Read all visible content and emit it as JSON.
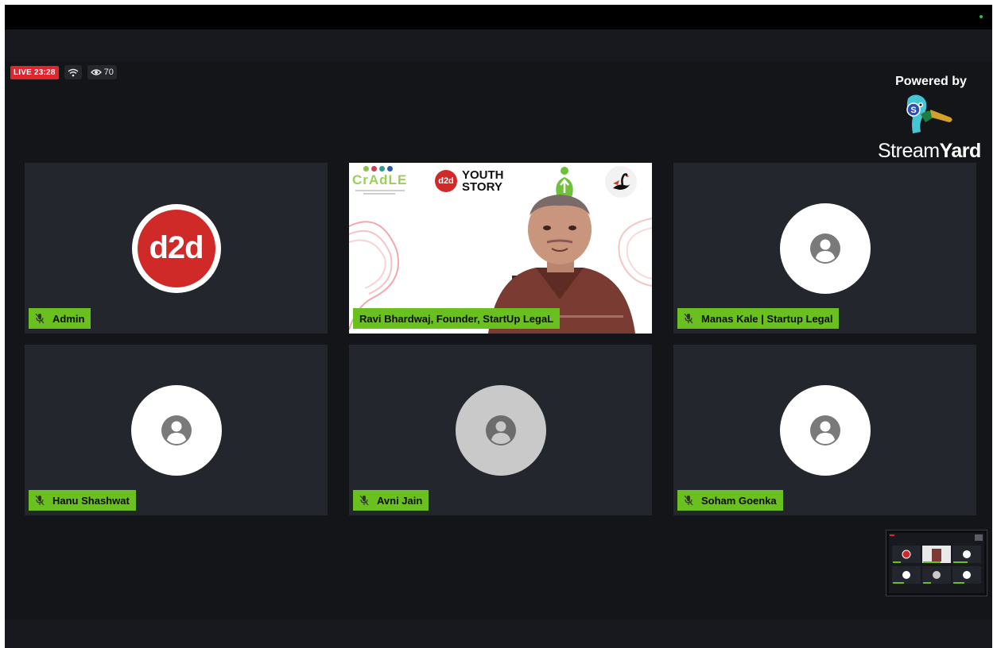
{
  "stream": {
    "live_label": "LIVE 23:28",
    "viewer_count": "70",
    "icons": {
      "connection": "wifi-icon",
      "viewers": "eye-icon"
    }
  },
  "branding": {
    "powered_by": "Powered by",
    "logo_word_light": "Stream",
    "logo_word_bold": "Yard",
    "logo_icon": "duck-mascot-icon",
    "logo_badge": "S"
  },
  "participants": [
    {
      "name": "Admin",
      "avatar": "d2d-logo",
      "avatar_text": "d2d",
      "muted": true
    },
    {
      "name": "Ravi Bhardwaj, Founder, StartUp LegaL",
      "avatar": "video",
      "muted": false
    },
    {
      "name": "Manas Kale | Startup Legal",
      "avatar": "person-icon",
      "muted": true
    },
    {
      "name": "Hanu Shashwat",
      "avatar": "person-icon",
      "muted": true
    },
    {
      "name": "Avni Jain",
      "avatar": "person-icon",
      "muted": true
    },
    {
      "name": "Soham Goenka",
      "avatar": "person-icon",
      "muted": true
    }
  ],
  "featured_banner": {
    "cradle_text": "CrAdLE",
    "d2d_badge": "d2d",
    "youth_line1": "YOUTH",
    "youth_line2": "STORY"
  },
  "colors": {
    "background": "#141519",
    "tile": "#23262d",
    "nameplate": "#6ac01f",
    "live": "#e0262d",
    "d2d_red": "#cf2a27"
  }
}
